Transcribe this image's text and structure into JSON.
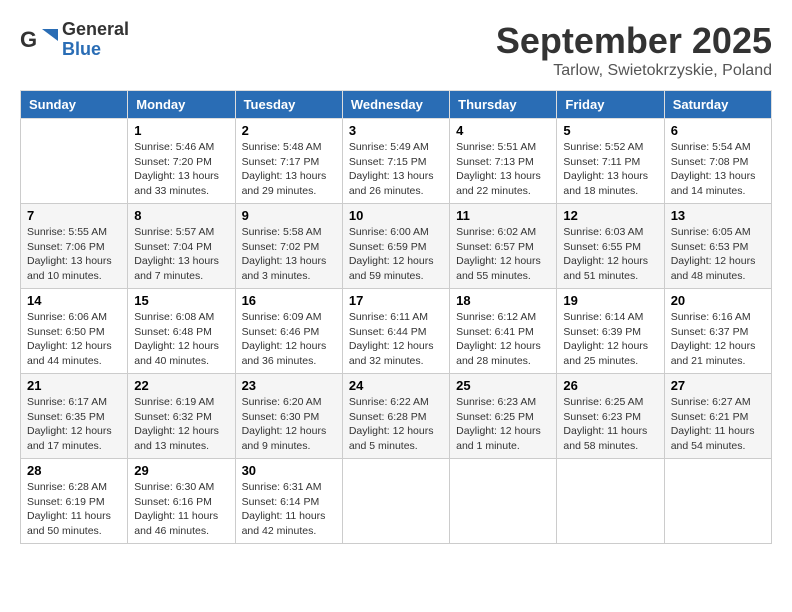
{
  "header": {
    "logo_line1": "General",
    "logo_line2": "Blue",
    "month": "September 2025",
    "location": "Tarlow, Swietokrzyskie, Poland"
  },
  "weekdays": [
    "Sunday",
    "Monday",
    "Tuesday",
    "Wednesday",
    "Thursday",
    "Friday",
    "Saturday"
  ],
  "weeks": [
    [
      {
        "day": "",
        "info": ""
      },
      {
        "day": "1",
        "info": "Sunrise: 5:46 AM\nSunset: 7:20 PM\nDaylight: 13 hours\nand 33 minutes."
      },
      {
        "day": "2",
        "info": "Sunrise: 5:48 AM\nSunset: 7:17 PM\nDaylight: 13 hours\nand 29 minutes."
      },
      {
        "day": "3",
        "info": "Sunrise: 5:49 AM\nSunset: 7:15 PM\nDaylight: 13 hours\nand 26 minutes."
      },
      {
        "day": "4",
        "info": "Sunrise: 5:51 AM\nSunset: 7:13 PM\nDaylight: 13 hours\nand 22 minutes."
      },
      {
        "day": "5",
        "info": "Sunrise: 5:52 AM\nSunset: 7:11 PM\nDaylight: 13 hours\nand 18 minutes."
      },
      {
        "day": "6",
        "info": "Sunrise: 5:54 AM\nSunset: 7:08 PM\nDaylight: 13 hours\nand 14 minutes."
      }
    ],
    [
      {
        "day": "7",
        "info": "Sunrise: 5:55 AM\nSunset: 7:06 PM\nDaylight: 13 hours\nand 10 minutes."
      },
      {
        "day": "8",
        "info": "Sunrise: 5:57 AM\nSunset: 7:04 PM\nDaylight: 13 hours\nand 7 minutes."
      },
      {
        "day": "9",
        "info": "Sunrise: 5:58 AM\nSunset: 7:02 PM\nDaylight: 13 hours\nand 3 minutes."
      },
      {
        "day": "10",
        "info": "Sunrise: 6:00 AM\nSunset: 6:59 PM\nDaylight: 12 hours\nand 59 minutes."
      },
      {
        "day": "11",
        "info": "Sunrise: 6:02 AM\nSunset: 6:57 PM\nDaylight: 12 hours\nand 55 minutes."
      },
      {
        "day": "12",
        "info": "Sunrise: 6:03 AM\nSunset: 6:55 PM\nDaylight: 12 hours\nand 51 minutes."
      },
      {
        "day": "13",
        "info": "Sunrise: 6:05 AM\nSunset: 6:53 PM\nDaylight: 12 hours\nand 48 minutes."
      }
    ],
    [
      {
        "day": "14",
        "info": "Sunrise: 6:06 AM\nSunset: 6:50 PM\nDaylight: 12 hours\nand 44 minutes."
      },
      {
        "day": "15",
        "info": "Sunrise: 6:08 AM\nSunset: 6:48 PM\nDaylight: 12 hours\nand 40 minutes."
      },
      {
        "day": "16",
        "info": "Sunrise: 6:09 AM\nSunset: 6:46 PM\nDaylight: 12 hours\nand 36 minutes."
      },
      {
        "day": "17",
        "info": "Sunrise: 6:11 AM\nSunset: 6:44 PM\nDaylight: 12 hours\nand 32 minutes."
      },
      {
        "day": "18",
        "info": "Sunrise: 6:12 AM\nSunset: 6:41 PM\nDaylight: 12 hours\nand 28 minutes."
      },
      {
        "day": "19",
        "info": "Sunrise: 6:14 AM\nSunset: 6:39 PM\nDaylight: 12 hours\nand 25 minutes."
      },
      {
        "day": "20",
        "info": "Sunrise: 6:16 AM\nSunset: 6:37 PM\nDaylight: 12 hours\nand 21 minutes."
      }
    ],
    [
      {
        "day": "21",
        "info": "Sunrise: 6:17 AM\nSunset: 6:35 PM\nDaylight: 12 hours\nand 17 minutes."
      },
      {
        "day": "22",
        "info": "Sunrise: 6:19 AM\nSunset: 6:32 PM\nDaylight: 12 hours\nand 13 minutes."
      },
      {
        "day": "23",
        "info": "Sunrise: 6:20 AM\nSunset: 6:30 PM\nDaylight: 12 hours\nand 9 minutes."
      },
      {
        "day": "24",
        "info": "Sunrise: 6:22 AM\nSunset: 6:28 PM\nDaylight: 12 hours\nand 5 minutes."
      },
      {
        "day": "25",
        "info": "Sunrise: 6:23 AM\nSunset: 6:25 PM\nDaylight: 12 hours\nand 1 minute."
      },
      {
        "day": "26",
        "info": "Sunrise: 6:25 AM\nSunset: 6:23 PM\nDaylight: 11 hours\nand 58 minutes."
      },
      {
        "day": "27",
        "info": "Sunrise: 6:27 AM\nSunset: 6:21 PM\nDaylight: 11 hours\nand 54 minutes."
      }
    ],
    [
      {
        "day": "28",
        "info": "Sunrise: 6:28 AM\nSunset: 6:19 PM\nDaylight: 11 hours\nand 50 minutes."
      },
      {
        "day": "29",
        "info": "Sunrise: 6:30 AM\nSunset: 6:16 PM\nDaylight: 11 hours\nand 46 minutes."
      },
      {
        "day": "30",
        "info": "Sunrise: 6:31 AM\nSunset: 6:14 PM\nDaylight: 11 hours\nand 42 minutes."
      },
      {
        "day": "",
        "info": ""
      },
      {
        "day": "",
        "info": ""
      },
      {
        "day": "",
        "info": ""
      },
      {
        "day": "",
        "info": ""
      }
    ]
  ]
}
